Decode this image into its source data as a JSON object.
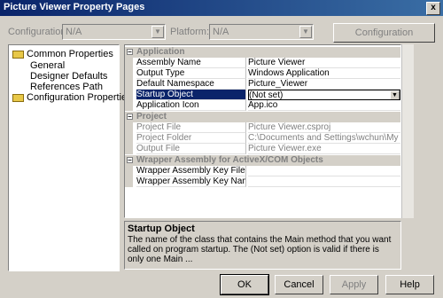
{
  "window": {
    "title": "Picture Viewer Property Pages",
    "close_glyph": "x"
  },
  "top": {
    "configuration_label": "Configuration:",
    "configuration_value": "N/A",
    "platform_label": "Platform:",
    "platform_value": "N/A",
    "config_manager_label": "Configuration Manager..."
  },
  "tree": {
    "root": "Common Properties",
    "children": [
      "General",
      "Designer Defaults",
      "References Path"
    ],
    "config": "Configuration Properties"
  },
  "grid": {
    "application": {
      "category": "Application",
      "rows": [
        {
          "name": "Assembly Name",
          "value": "Picture Viewer"
        },
        {
          "name": "Output Type",
          "value": "Windows Application"
        },
        {
          "name": "Default Namespace",
          "value": "Picture_Viewer"
        },
        {
          "name": "Startup Object",
          "value": "(Not set)"
        },
        {
          "name": "Application Icon",
          "value": "App.ico"
        }
      ]
    },
    "project": {
      "category": "Project",
      "rows": [
        {
          "name": "Project File",
          "value": "Picture Viewer.csproj"
        },
        {
          "name": "Project Folder",
          "value": "C:\\Documents and Settings\\wchun\\My Docume"
        },
        {
          "name": "Output File",
          "value": "Picture Viewer.exe"
        }
      ]
    },
    "wrapper": {
      "category": "Wrapper Assembly for ActiveX/COM Objects",
      "rows": [
        {
          "name": "Wrapper Assembly Key File",
          "value": ""
        },
        {
          "name": "Wrapper Assembly Key Name",
          "value": ""
        }
      ]
    }
  },
  "description": {
    "title": "Startup Object",
    "body": "The name of the class that contains the Main method that you want called on program startup. The (Not set) option is valid if there is only one Main ..."
  },
  "buttons": {
    "ok": "OK",
    "cancel": "Cancel",
    "apply": "Apply",
    "help": "Help"
  }
}
